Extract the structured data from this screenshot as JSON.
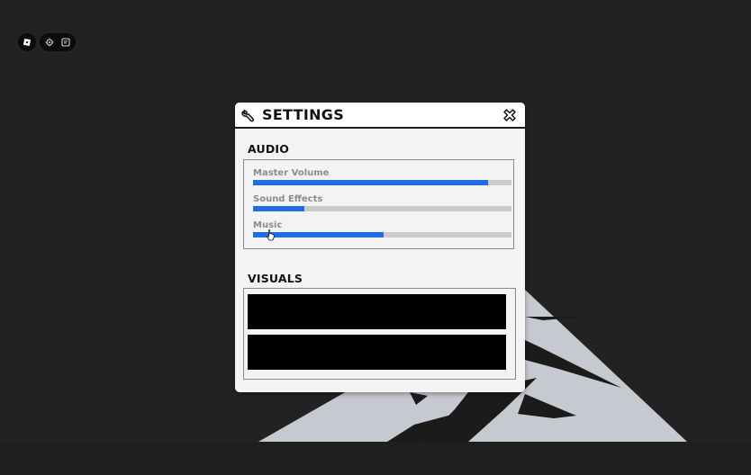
{
  "settings": {
    "title": "SETTINGS",
    "audio": {
      "title": "AUDIO",
      "sliders": [
        {
          "label": "Master Volume",
          "value": 0.91
        },
        {
          "label": "Sound Effects",
          "value": 0.2
        },
        {
          "label": "Music",
          "value": 0.505
        }
      ]
    },
    "visuals": {
      "title": "VISUALS"
    }
  },
  "colors": {
    "background": "#222222",
    "panel": "#f4f4f4",
    "slider_fill": "#1e6ee6",
    "slider_track": "#cccccc",
    "label_gray": "#8c8c8c",
    "scene_gray": "#c7c9d0"
  },
  "icons": {
    "menu": "roblox-menu-icon",
    "pill": [
      "gear-icon",
      "chat-icon"
    ],
    "header": "wrench-icon",
    "close": "close-icon"
  }
}
